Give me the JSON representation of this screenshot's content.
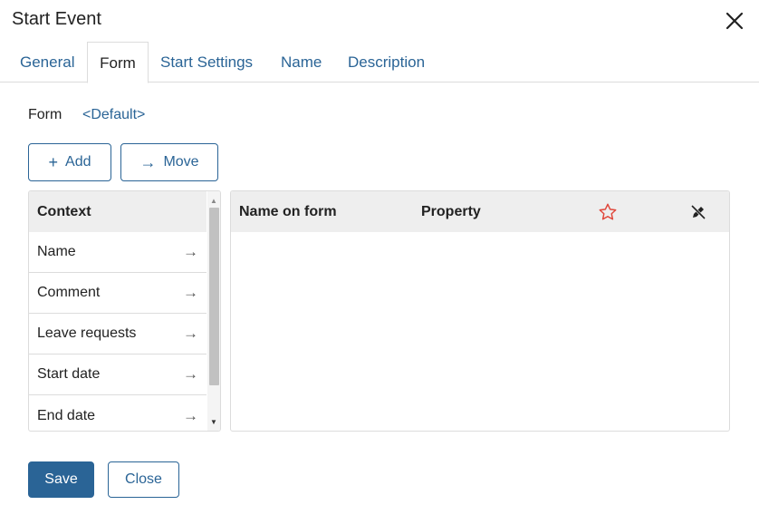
{
  "dialog": {
    "title": "Start Event"
  },
  "tabs": [
    {
      "label": "General",
      "active": false
    },
    {
      "label": "Form",
      "active": true
    },
    {
      "label": "Start Settings",
      "active": false
    },
    {
      "label": "Name",
      "active": false
    },
    {
      "label": "Description",
      "active": false
    }
  ],
  "form": {
    "label": "Form",
    "value": "<Default>"
  },
  "toolbar": {
    "add_label": "Add",
    "add_icon": "+",
    "move_label": "Move",
    "move_icon": "→"
  },
  "context": {
    "header": "Context",
    "items": [
      {
        "label": "Name",
        "arrow": "→"
      },
      {
        "label": "Comment",
        "arrow": "→"
      },
      {
        "label": "Leave requests",
        "arrow": "→"
      },
      {
        "label": "Start date",
        "arrow": "→"
      },
      {
        "label": "End date",
        "arrow": "→"
      }
    ]
  },
  "fields": {
    "col_name": "Name on form",
    "col_property": "Property",
    "required_icon": "star-icon",
    "readonly_icon": "pencil-off-icon",
    "rows": []
  },
  "footer": {
    "save_label": "Save",
    "close_label": "Close"
  },
  "colors": {
    "accent": "#2a6496",
    "required_star": "#e0463a",
    "header_bg": "#eeeeee"
  }
}
